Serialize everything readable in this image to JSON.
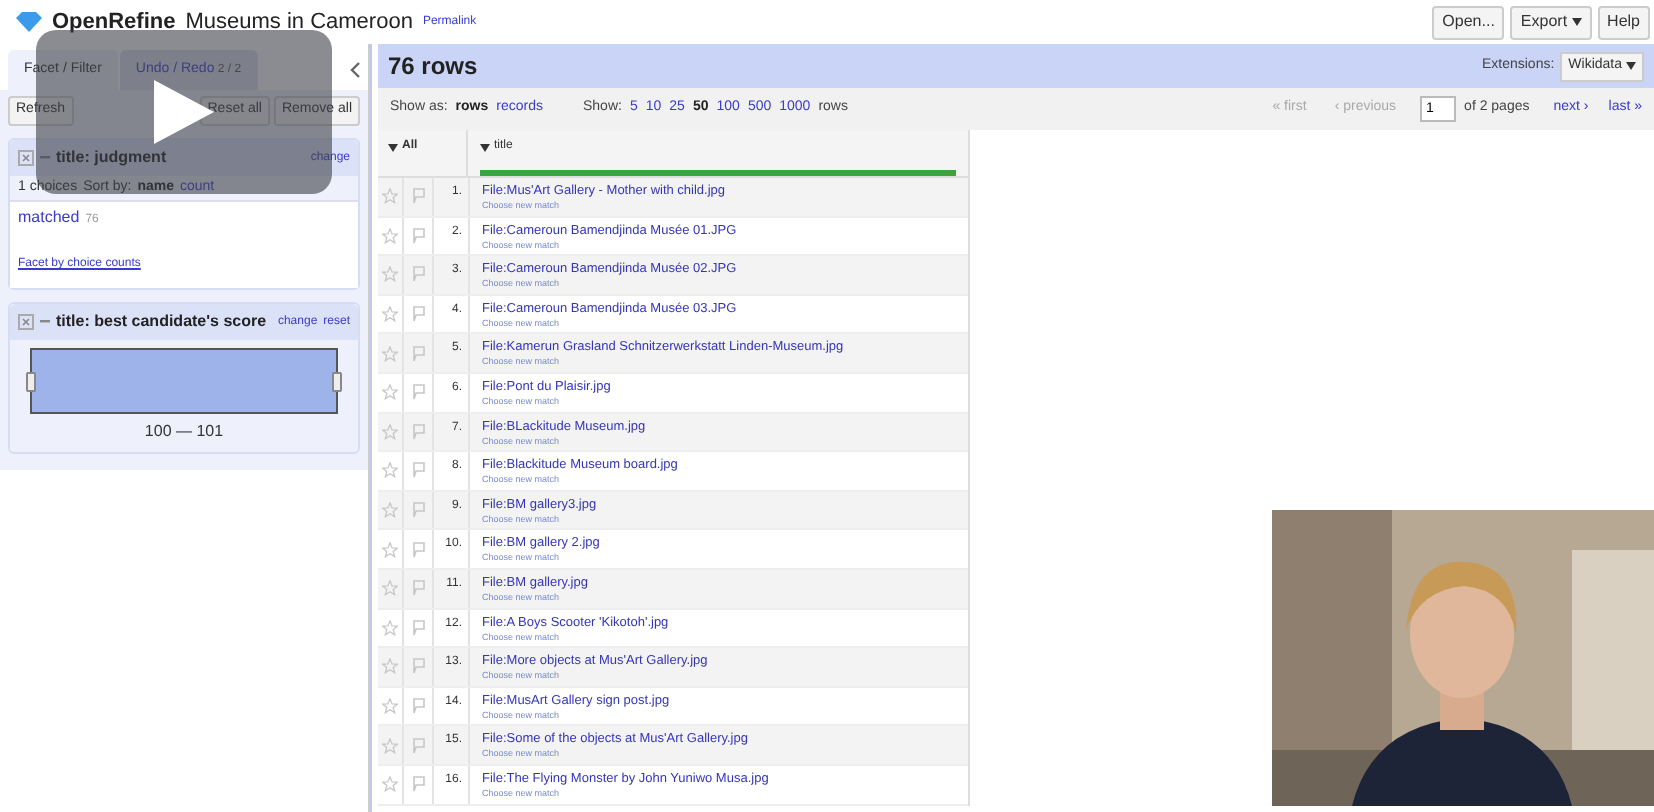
{
  "app": {
    "name": "OpenRefine",
    "project": "Museums in Cameroon",
    "permalink": "Permalink",
    "buttons": [
      {
        "label": "Open...",
        "caret": false
      },
      {
        "label": "Export",
        "caret": true
      },
      {
        "label": "Help",
        "caret": false
      }
    ]
  },
  "left_panel": {
    "tabs": [
      {
        "label": "Facet / Filter",
        "selected": true
      },
      {
        "label": "Undo / Redo",
        "count": "2 / 2",
        "selected": false
      }
    ],
    "actions": [
      "Refresh",
      "Reset all",
      "Remove all"
    ],
    "facets": [
      {
        "kind": "list",
        "title": "title: judgment",
        "links": [
          "change"
        ],
        "summary": "1 choices",
        "sort_label": "Sort by:",
        "sort_options": [
          {
            "label": "name",
            "selected": true
          },
          {
            "label": "count",
            "selected": false
          }
        ],
        "choices": [
          {
            "name": "matched",
            "count": "76"
          }
        ],
        "footer_link": "Facet by choice counts"
      },
      {
        "kind": "range",
        "title": "title: best candidate's score",
        "links": [
          "change",
          "reset"
        ],
        "range_label": "100 — 101"
      }
    ]
  },
  "grid": {
    "row_count": "76 rows",
    "extensions_label": "Extensions:",
    "extensions_menu": "Wikidata",
    "show_as_label": "Show as:",
    "show_as": [
      {
        "label": "rows",
        "selected": true
      },
      {
        "label": "records",
        "selected": false
      }
    ],
    "show_label": "Show:",
    "page_sizes": [
      {
        "label": "5",
        "selected": false
      },
      {
        "label": "10",
        "selected": false
      },
      {
        "label": "25",
        "selected": false
      },
      {
        "label": "50",
        "selected": true
      },
      {
        "label": "100",
        "selected": false
      },
      {
        "label": "500",
        "selected": false
      },
      {
        "label": "1000",
        "selected": false
      }
    ],
    "rows_word": "rows",
    "pager": {
      "first": "« first",
      "previous": "‹ previous",
      "page": "1",
      "of_pages": "of 2 pages",
      "next": "next ›",
      "last": "last »"
    },
    "columns": [
      {
        "label": "All"
      },
      {
        "label": "title",
        "level": 1
      }
    ],
    "rows": [
      {
        "number": "1.",
        "title": "File:Mus'Art Gallery - Mother with child.jpg",
        "action": "Choose new match"
      },
      {
        "number": "2.",
        "title": "File:Cameroun Bamendjinda Musée 01.JPG",
        "action": "Choose new match"
      },
      {
        "number": "3.",
        "title": "File:Cameroun Bamendjinda Musée 02.JPG",
        "action": "Choose new match"
      },
      {
        "number": "4.",
        "title": "File:Cameroun Bamendjinda Musée 03.JPG",
        "action": "Choose new match"
      },
      {
        "number": "5.",
        "title": "File:Kamerun Grasland Schnitzerwerkstatt Linden-Museum.jpg",
        "action": "Choose new match"
      },
      {
        "number": "6.",
        "title": "File:Pont du Plaisir.jpg",
        "action": "Choose new match"
      },
      {
        "number": "7.",
        "title": "File:BLackitude Museum.jpg",
        "action": "Choose new match"
      },
      {
        "number": "8.",
        "title": "File:Blackitude Museum board.jpg",
        "action": "Choose new match"
      },
      {
        "number": "9.",
        "title": "File:BM gallery3.jpg",
        "action": "Choose new match"
      },
      {
        "number": "10.",
        "title": "File:BM gallery 2.jpg",
        "action": "Choose new match"
      },
      {
        "number": "11.",
        "title": "File:BM gallery.jpg",
        "action": "Choose new match"
      },
      {
        "number": "12.",
        "title": "File:A Boys Scooter 'Kikotoh'.jpg",
        "action": "Choose new match"
      },
      {
        "number": "13.",
        "title": "File:More objects at Mus'Art Gallery.jpg",
        "action": "Choose new match"
      },
      {
        "number": "14.",
        "title": "File:MusArt Gallery sign post.jpg",
        "action": "Choose new match"
      },
      {
        "number": "15.",
        "title": "File:Some of the objects at Mus'Art Gallery.jpg",
        "action": "Choose new match"
      },
      {
        "number": "16.",
        "title": "File:The Flying Monster by John Yuniwo Musa.jpg",
        "action": "Choose new match"
      }
    ]
  },
  "video": {
    "play_button": true
  }
}
